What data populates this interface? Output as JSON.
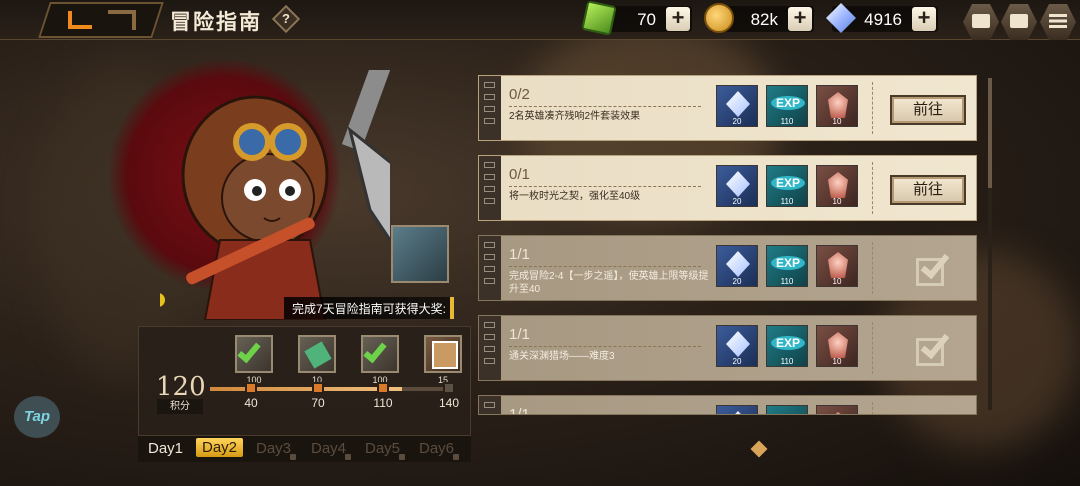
{
  "header": {
    "title": "冒险指南",
    "help_label": "?"
  },
  "resources": {
    "energy": "70",
    "gold": "82k",
    "diamonds": "4916",
    "plus": "+"
  },
  "reward_panel": {
    "banner": "完成7天冒险指南可获得大奖:",
    "score": "120",
    "score_label": "积分",
    "progress": 0.8,
    "items": [
      {
        "icon": "checked-ticket-icon",
        "qty": "100",
        "claimed": true
      },
      {
        "icon": "ticket-icon",
        "qty": "10",
        "claimed": false
      },
      {
        "icon": "checked-ticket-icon",
        "qty": "100",
        "claimed": true
      },
      {
        "icon": "hero-card-icon",
        "qty": "15",
        "claimed": false
      }
    ],
    "milestones": [
      "40",
      "70",
      "110",
      "140"
    ],
    "days": [
      "Day1",
      "Day2",
      "Day3",
      "Day4",
      "Day5",
      "Day6"
    ],
    "active_day": "Day2"
  },
  "tap_label": "Tap",
  "quests": [
    {
      "progress": "0/2",
      "desc": "2名英雄凑齐残响2件套装效果",
      "rewards": [
        "20",
        "110",
        "10"
      ],
      "exp_label": "EXP",
      "action": "前往",
      "done": false
    },
    {
      "progress": "0/1",
      "desc": "将一枚时光之契，强化至40级",
      "rewards": [
        "20",
        "110",
        "10"
      ],
      "exp_label": "EXP",
      "action": "前往",
      "done": false
    },
    {
      "progress": "1/1",
      "desc": "完成冒险2-4【一步之遥】，使英雄上限等级提升至40",
      "rewards": [
        "20",
        "110",
        "10"
      ],
      "exp_label": "EXP",
      "action": "",
      "done": true
    },
    {
      "progress": "1/1",
      "desc": "通关深渊猎场——难度3",
      "rewards": [
        "20",
        "110",
        "10"
      ],
      "exp_label": "EXP",
      "action": "",
      "done": true
    },
    {
      "progress": "1/1",
      "desc": "",
      "rewards": [
        "",
        "",
        ""
      ],
      "exp_label": "",
      "action": "",
      "done": true
    }
  ],
  "colors": {
    "accent": "#f08a1c",
    "active_day": "#ffd55c",
    "progress_fill": "#d97a2b"
  }
}
